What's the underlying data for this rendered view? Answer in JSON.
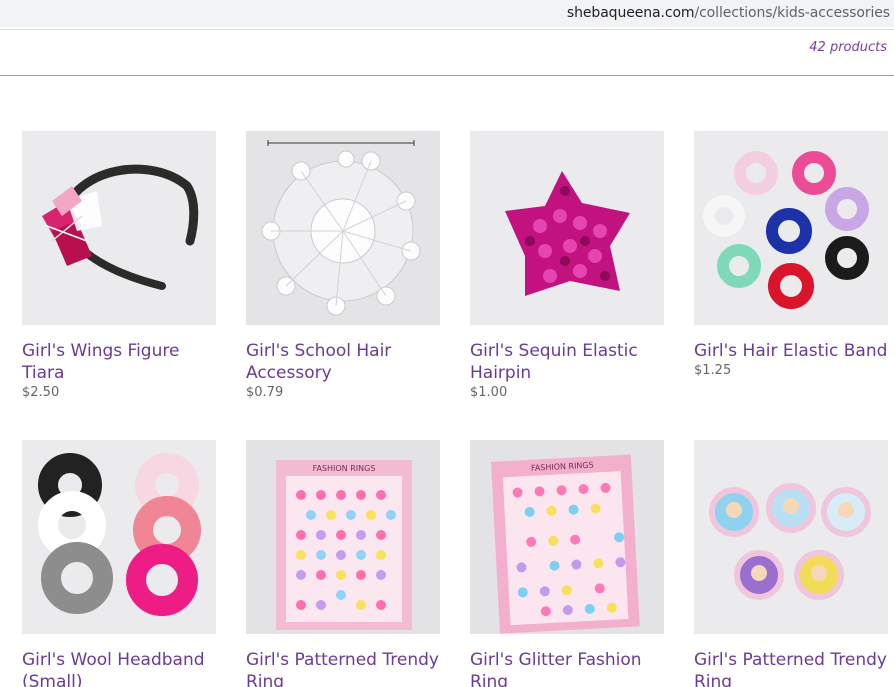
{
  "browser": {
    "url_host": "shebaqueena.com",
    "url_path": "/collections/kids-accessories"
  },
  "collection": {
    "count_text": "42 products"
  },
  "products": [
    {
      "title": "Girl's Wings Figure Tiara",
      "price": "$2.50",
      "icon": "headband-image"
    },
    {
      "title": "Girl's School Hair Accessory",
      "price": "$0.79",
      "icon": "hair-bun-cover-image"
    },
    {
      "title": "Girl's Sequin Elastic Hairpin",
      "price": "$1.00",
      "icon": "sequin-crown-image"
    },
    {
      "title": "Girl's Hair Elastic Band",
      "price": "$1.25",
      "icon": "scrunchies-image"
    },
    {
      "title": "Girl's Wool Headband (Small)",
      "price": "",
      "icon": "fur-headbands-image"
    },
    {
      "title": "Girl's Patterned Trendy Ring",
      "price": "",
      "icon": "ring-box-image"
    },
    {
      "title": "Girl's Glitter Fashion Ring",
      "price": "",
      "icon": "ring-box-image"
    },
    {
      "title": "Girl's Patterned Trendy Ring",
      "price": "",
      "icon": "cartoon-rings-image"
    }
  ],
  "images": {
    "fashion_rings_label": "FASHION RINGS"
  },
  "colors": {
    "link": "#6a3a97",
    "accent_line": "#b8a36a",
    "thumb_bg": "#e8e8ea"
  }
}
